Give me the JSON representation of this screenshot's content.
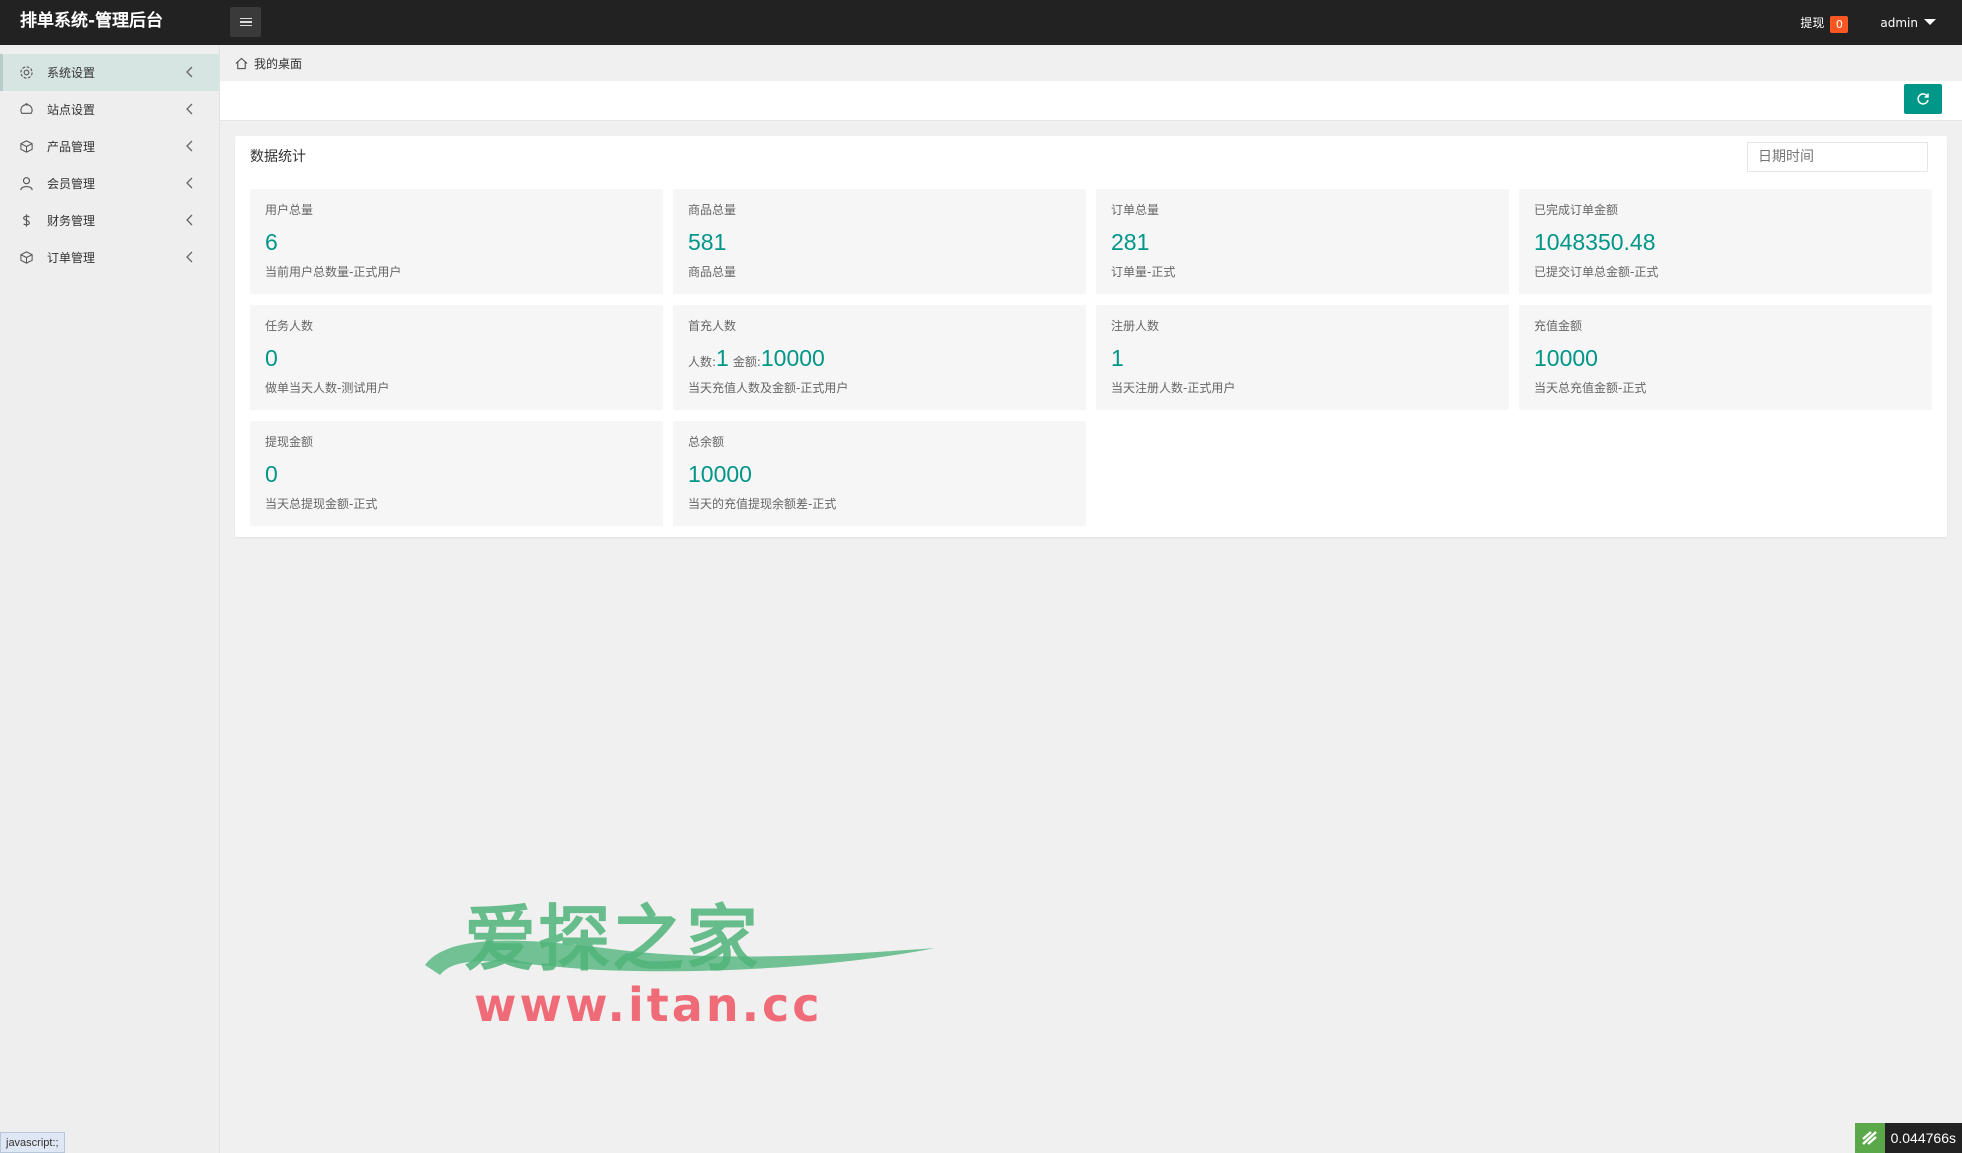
{
  "header": {
    "title": "排单系统-管理后台",
    "withdraw_label": "提现",
    "withdraw_count": "0",
    "user": "admin"
  },
  "sidebar": {
    "items": [
      {
        "label": "系统设置",
        "icon": "gear-icon"
      },
      {
        "label": "站点设置",
        "icon": "site-icon"
      },
      {
        "label": "产品管理",
        "icon": "box-icon"
      },
      {
        "label": "会员管理",
        "icon": "user-icon"
      },
      {
        "label": "财务管理",
        "icon": "dollar-icon"
      },
      {
        "label": "订单管理",
        "icon": "box-icon"
      }
    ]
  },
  "breadcrumb": {
    "label": "我的桌面"
  },
  "panel": {
    "title": "数据统计",
    "date_placeholder": "日期时间"
  },
  "stats": [
    {
      "title": "用户总量",
      "value": "6",
      "desc": "当前用户总数量-正式用户"
    },
    {
      "title": "商品总量",
      "value": "581",
      "desc": "商品总量"
    },
    {
      "title": "订单总量",
      "value": "281",
      "desc": "订单量-正式"
    },
    {
      "title": "已完成订单金额",
      "value": "1048350.48",
      "desc": "已提交订单总金额-正式"
    },
    {
      "title": "任务人数",
      "value": "0",
      "desc": "做单当天人数-测试用户"
    },
    {
      "title": "首充人数",
      "count_label": "人数:",
      "count": "1",
      "amount_label": "金额:",
      "amount": "10000",
      "desc": "当天充值人数及金额-正式用户"
    },
    {
      "title": "注册人数",
      "value": "1",
      "desc": "当天注册人数-正式用户"
    },
    {
      "title": "充值金额",
      "value": "10000",
      "desc": "当天总充值金额-正式"
    },
    {
      "title": "提现金额",
      "value": "0",
      "desc": "当天总提现金额-正式"
    },
    {
      "title": "总余额",
      "value": "10000",
      "desc": "当天的充值提现余额差-正式"
    }
  ],
  "watermark": {
    "cn": "爱探之家",
    "en": "www.itan.cc"
  },
  "status": {
    "url": "javascript:;",
    "timer": "0.044766s"
  },
  "colors": {
    "accent": "#009688",
    "header": "#222222",
    "badge": "#ff5722"
  }
}
